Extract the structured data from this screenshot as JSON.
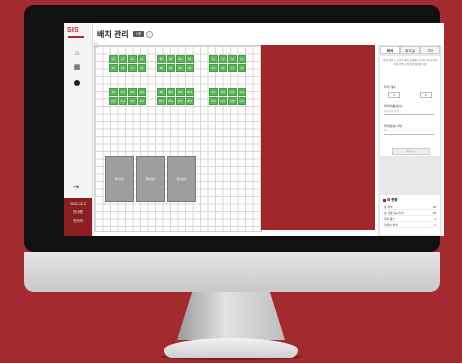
{
  "app": {
    "logo": "SIS",
    "title": "배치 관리",
    "floor": "1층",
    "help": "?"
  },
  "nav": {
    "user_lines": [
      "2021.12.3",
      "안내원",
      "관리자"
    ]
  },
  "seat_blocks": [
    {
      "rows": [
        [
          "A1",
          "A2",
          "A3",
          "A4"
        ],
        [
          "A5",
          "A6",
          "A7",
          "A8"
        ]
      ]
    },
    {
      "rows": [
        [
          "B1",
          "B2",
          "B3",
          "B4"
        ],
        [
          "B5",
          "B6",
          "B7",
          "B8"
        ]
      ]
    },
    {
      "rows": [
        [
          "C1",
          "C2",
          "C3",
          "C4"
        ],
        [
          "C5",
          "C6",
          "C7",
          "C8"
        ]
      ]
    },
    {
      "rows": [
        [
          "A9",
          "A10",
          "A11",
          "A12"
        ],
        [
          "A13",
          "A14",
          "A15",
          "A16"
        ]
      ]
    },
    {
      "rows": [
        [
          "B9",
          "B10",
          "B11",
          "B12"
        ],
        [
          "B13",
          "B14",
          "B15",
          "B16"
        ]
      ]
    },
    {
      "rows": [
        [
          "C9",
          "C10",
          "C11",
          "C12"
        ],
        [
          "C13",
          "C14",
          "C15",
          "C16"
        ]
      ]
    }
  ],
  "rooms": [
    "회의실1",
    "회의실2",
    "회의실3"
  ],
  "panel": {
    "tabs": [
      "좌석",
      "회의실",
      "기타"
    ],
    "description": "좌석 선택 시 오른쪽 에서 상세정보 입니다 좌석 유형 변경 선택 시 편집된 배치를 저장",
    "count_label": "좌석 개수",
    "count_values": [
      "4",
      "2"
    ],
    "name_label": "좌석이름(필수)",
    "name_placeholder": "좌석이름 입력",
    "seat_code_label": "좌석번호(시작)",
    "seat_code_placeholder": "A1",
    "apply_label": "배치하기"
  },
  "stats": {
    "title": "좌 현황",
    "rows": [
      {
        "label": "총 좌석",
        "value": "48"
      },
      {
        "label": "총 사용가능 좌석",
        "value": "48"
      },
      {
        "label": "회의 룸수",
        "value": "3"
      },
      {
        "label": "회의실 좌석",
        "value": "0"
      }
    ]
  }
}
